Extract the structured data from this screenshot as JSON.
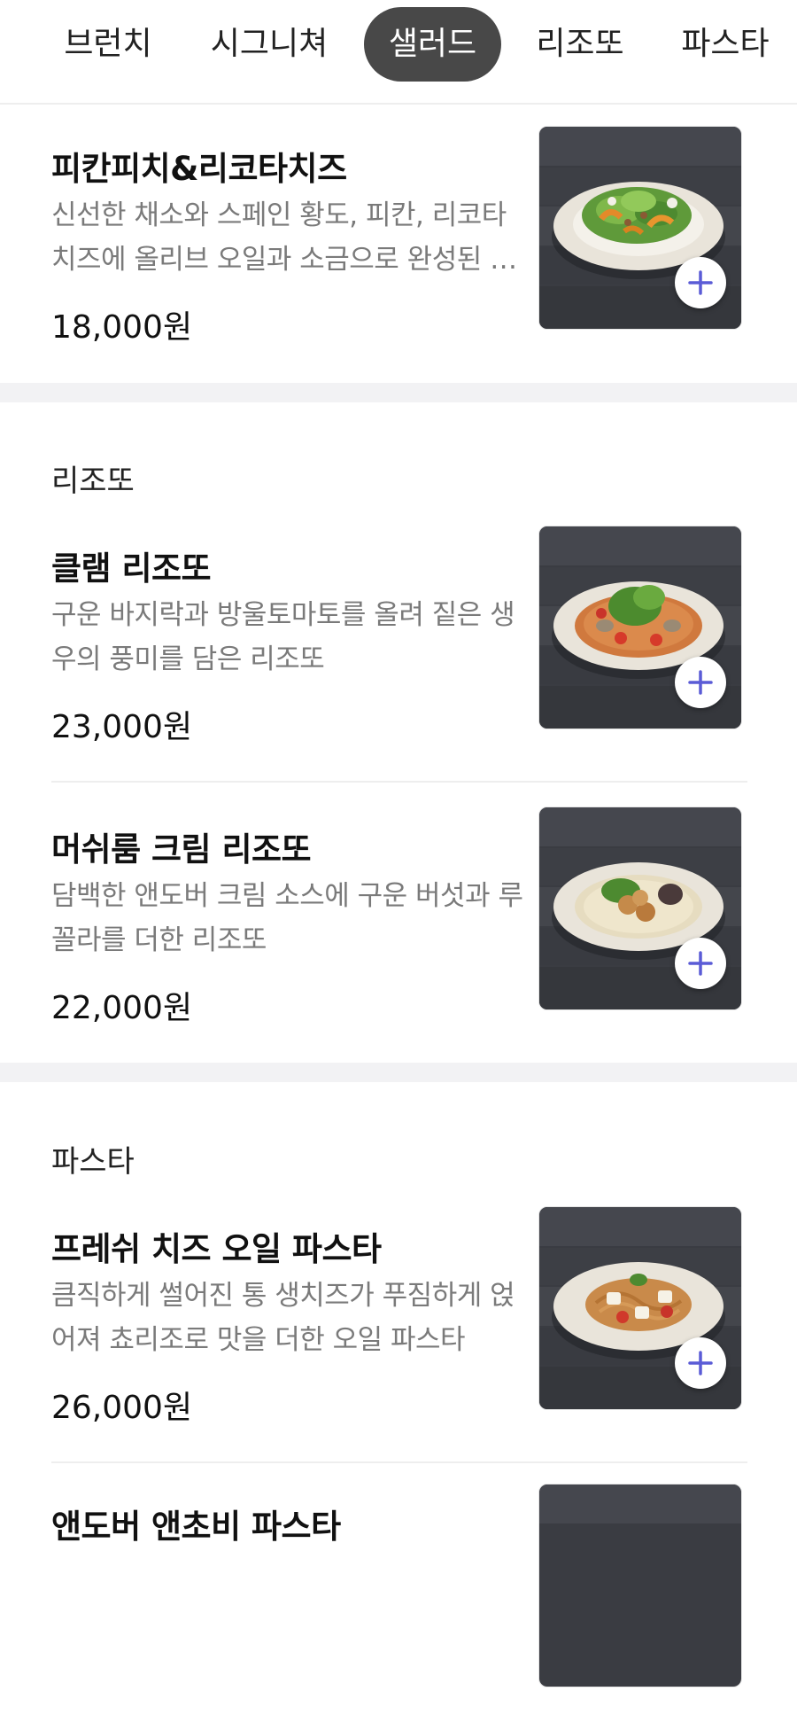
{
  "tabs": [
    {
      "label": "브런치",
      "active": false
    },
    {
      "label": "시그니쳐",
      "active": false
    },
    {
      "label": "샐러드",
      "active": true
    },
    {
      "label": "리조또",
      "active": false
    },
    {
      "label": "파스타",
      "active": false
    }
  ],
  "items": [
    {
      "name": "피칸피치&리코타치즈",
      "desc": "신선한 채소와 스페인 황도, 피칸, 리코타 치즈에 올리브 오일과 소금으로 완성된 …",
      "price": "18,000원",
      "dish": "salad"
    },
    {
      "name": "클램 리조또",
      "desc": "구운 바지락과 방울토마토를 올려 짙은 생우의 풍미를 담은 리조또",
      "price": "23,000원",
      "dish": "risotto-clam"
    },
    {
      "name": "머쉬룸 크림 리조또",
      "desc": "담백한 앤도버 크림 소스에 구운 버섯과 루꼴라를 더한 리조또",
      "price": "22,000원",
      "dish": "risotto-mushroom"
    },
    {
      "name": "프레쉬 치즈 오일 파스타",
      "desc": "큼직하게 썰어진 통 생치즈가 푸짐하게 얹어져 쵸리조로 맛을 더한 오일 파스타",
      "price": "26,000원",
      "dish": "pasta"
    },
    {
      "name": "앤도버 앤초비 파스타",
      "desc": "",
      "price": "",
      "dish": "pasta-partial"
    }
  ],
  "sections": {
    "risotto": "리조또",
    "pasta": "파스타"
  },
  "icons": {
    "add": "plus-icon"
  },
  "colors": {
    "active_tab_bg": "#484848",
    "add_icon": "#5a5bd6",
    "description": "#7a7a7a",
    "band": "#f2f2f4"
  }
}
